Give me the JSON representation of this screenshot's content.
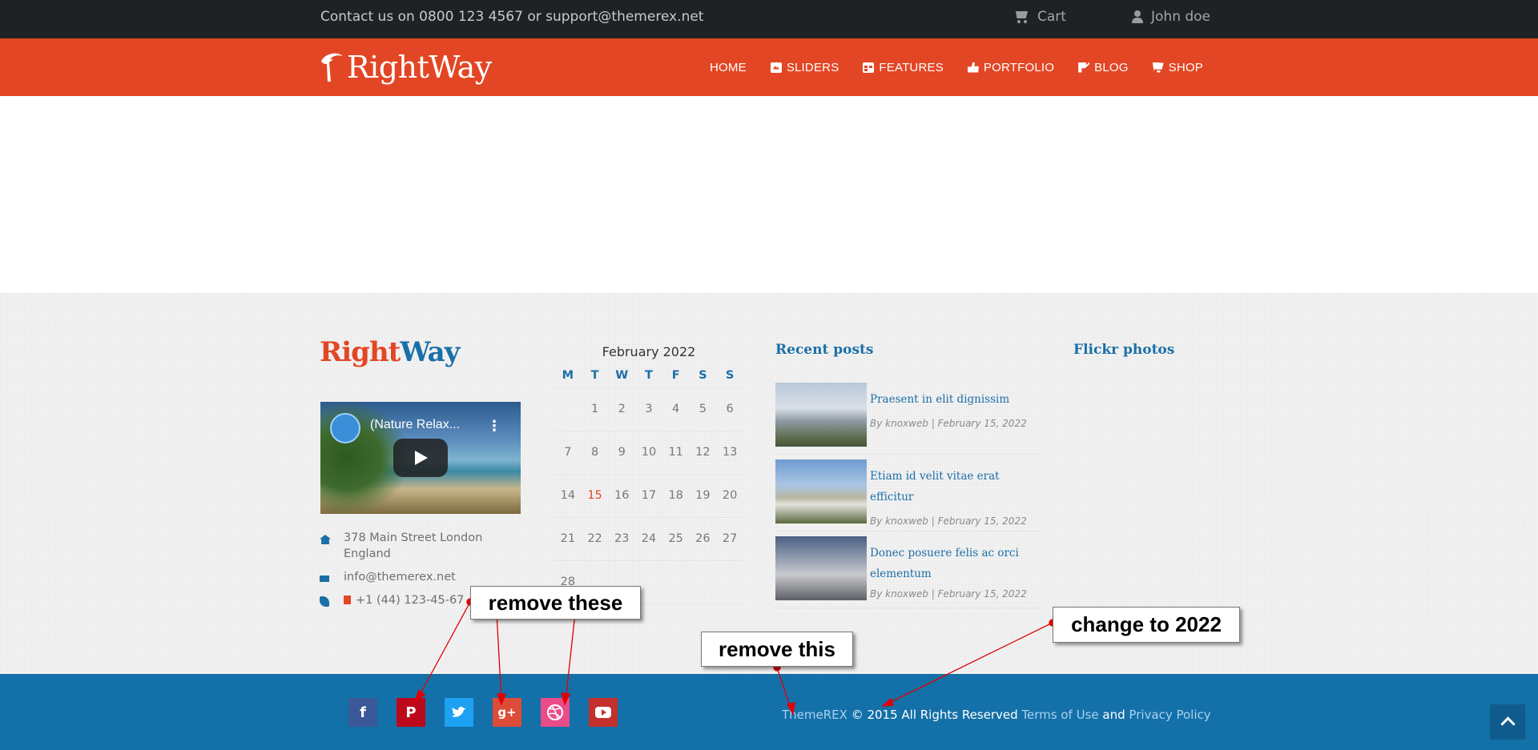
{
  "topbar": {
    "contact": "Contact us on 0800 123 4567 or support@themerex.net",
    "cart_label": "Cart",
    "user_label": "John doe"
  },
  "header": {
    "logo": "RightWay",
    "nav": [
      {
        "label": "HOME",
        "icon": ""
      },
      {
        "label": "SLIDERS",
        "icon": "image-icon"
      },
      {
        "label": "FEATURES",
        "icon": "features-icon"
      },
      {
        "label": "PORTFOLIO",
        "icon": "thumbs-up-icon"
      },
      {
        "label": "BLOG",
        "icon": "edit-icon"
      },
      {
        "label": "SHOP",
        "icon": "cart-icon"
      }
    ]
  },
  "footer_widgets": {
    "logo_part1": "Right",
    "logo_part2": "Way",
    "video": {
      "title": "(Nature Relax..."
    },
    "address": "378 Main Street London England",
    "email": "info@themerex.net",
    "phone": "+1 (44) 123-45-67",
    "calendar": {
      "month": "February 2022",
      "weekdays": [
        "M",
        "T",
        "W",
        "T",
        "F",
        "S",
        "S"
      ],
      "weeks": [
        [
          "",
          "1",
          "2",
          "3",
          "4",
          "5",
          "6"
        ],
        [
          "7",
          "8",
          "9",
          "10",
          "11",
          "12",
          "13"
        ],
        [
          "14",
          "15",
          "16",
          "17",
          "18",
          "19",
          "20"
        ],
        [
          "21",
          "22",
          "23",
          "24",
          "25",
          "26",
          "27"
        ],
        [
          "28",
          "",
          "",
          "",
          "",
          "",
          ""
        ]
      ],
      "today": "15"
    },
    "recent_posts": {
      "title": "Recent posts",
      "items": [
        {
          "title": "Praesent in elit dignissim",
          "meta": "By knoxweb | February 15, 2022"
        },
        {
          "title": "Etiam id velit vitae erat efficitur",
          "meta": "By knoxweb | February 15, 2022"
        },
        {
          "title": "Donec posuere felis ac orci elementum",
          "meta": "By knoxweb | February 15, 2022"
        }
      ]
    },
    "flickr_title": "Flickr photos"
  },
  "bottom": {
    "social": [
      "facebook",
      "pinterest",
      "twitter",
      "google-plus",
      "dribbble",
      "youtube"
    ],
    "copyright": {
      "brand": "ThemeREX",
      "text": " © 2015 All Rights Reserved ",
      "terms": "Terms of Use",
      "and": " and ",
      "privacy": "Privacy Policy"
    }
  },
  "annotations": {
    "remove_these": "remove these",
    "remove_this": "remove this",
    "change_year": "change to 2022"
  },
  "colors": {
    "topbar": "#1f2224",
    "brand_orange": "#e34624",
    "brand_blue": "#1470a8",
    "annotation_arrow": "#e00000"
  }
}
